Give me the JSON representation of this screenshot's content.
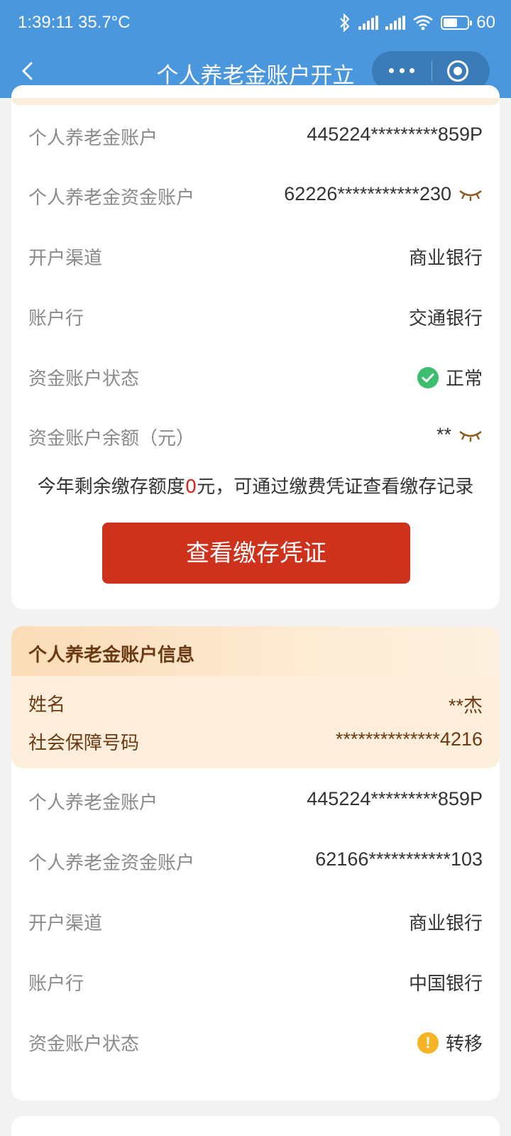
{
  "status_bar": {
    "time": "1:39:11",
    "temperature": "35.7°C",
    "battery": "60",
    "battery_level": 0.6
  },
  "nav": {
    "title": "个人养老金账户开立"
  },
  "account1": {
    "rows": [
      {
        "label": "个人养老金账户",
        "value": "445224*********859P"
      },
      {
        "label": "个人养老金资金账户",
        "value": "62226***********230"
      },
      {
        "label": "开户渠道",
        "value": "商业银行"
      },
      {
        "label": "账户行",
        "value": "交通银行"
      },
      {
        "label": "资金账户状态",
        "value": "正常"
      },
      {
        "label": "资金账户余额（元）",
        "value": "**"
      }
    ],
    "quota_prefix": "今年剩余缴存额度",
    "quota_amount": "0",
    "quota_suffix": "元，可通过缴费凭证查看缴存记录",
    "button_label": "查看缴存凭证"
  },
  "account2": {
    "section_title": "个人养老金账户信息",
    "name_label": "姓名",
    "name_value": "**杰",
    "ssn_label": "社会保障号码",
    "ssn_value": "**************4216",
    "rows": [
      {
        "label": "个人养老金账户",
        "value": "445224*********859P"
      },
      {
        "label": "个人养老金资金账户",
        "value": "62166***********103"
      },
      {
        "label": "开户渠道",
        "value": "商业银行"
      },
      {
        "label": "账户行",
        "value": "中国银行"
      },
      {
        "label": "资金账户状态",
        "value": "转移"
      }
    ]
  },
  "colors": {
    "primary": "#4a97dd",
    "button": "#ce321d",
    "ok": "#3bbf6e",
    "warn": "#f6b323",
    "highlight": "#d8261e"
  },
  "icons": [
    "back-arrow-icon",
    "more-icon",
    "target-icon",
    "eye-closed-icon",
    "check-circle-icon",
    "warning-icon",
    "bluetooth-icon",
    "wifi-icon",
    "signal-icon",
    "battery-icon"
  ]
}
